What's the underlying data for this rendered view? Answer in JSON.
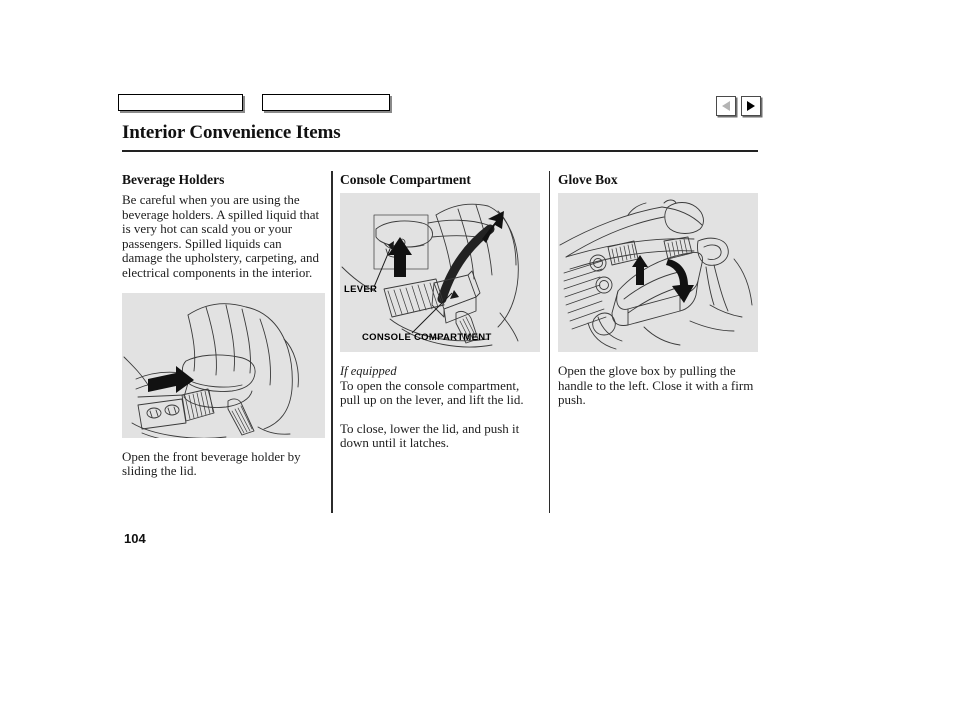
{
  "header": {
    "title": "Interior Convenience Items",
    "tabs": [
      {
        "label": "",
        "name": "tab-box-1"
      },
      {
        "label": "",
        "name": "tab-box-2"
      }
    ],
    "nav": {
      "prev_icon": "triangle-left-icon",
      "next_icon": "triangle-right-icon",
      "prev_enabled": false,
      "next_enabled": true
    }
  },
  "columns": [
    {
      "heading": "Beverage Holders",
      "body": "Be careful when you are using the beverage holders. A spilled liquid that is very hot can scald you or your passengers. Spilled liquids can damage the upholstery, carpeting, and electrical components in the interior.",
      "figure_alt": "center console beverage holder with sliding lid",
      "caption": "Open the front beverage holder by sliding the lid."
    },
    {
      "heading": "Console Compartment",
      "figure_alt": "console compartment with lever and lid",
      "callouts": {
        "lever": "LEVER",
        "compartment": "CONSOLE COMPARTMENT"
      },
      "note": "If equipped",
      "body_1": "To open the console compartment, pull up on the lever, and lift the lid.",
      "body_2": "To close, lower the lid, and push it down until it latches."
    },
    {
      "heading": "Glove Box",
      "figure_alt": "dashboard with open glove box",
      "body": "Open the glove box by pulling the handle to the left. Close it with a firm push."
    }
  ],
  "footer": {
    "page_number": "104"
  },
  "colors": {
    "figure_background": "#e2e2e2",
    "text": "#1d1d1d",
    "rule": "#222222",
    "arrow_fill": "#000000"
  }
}
